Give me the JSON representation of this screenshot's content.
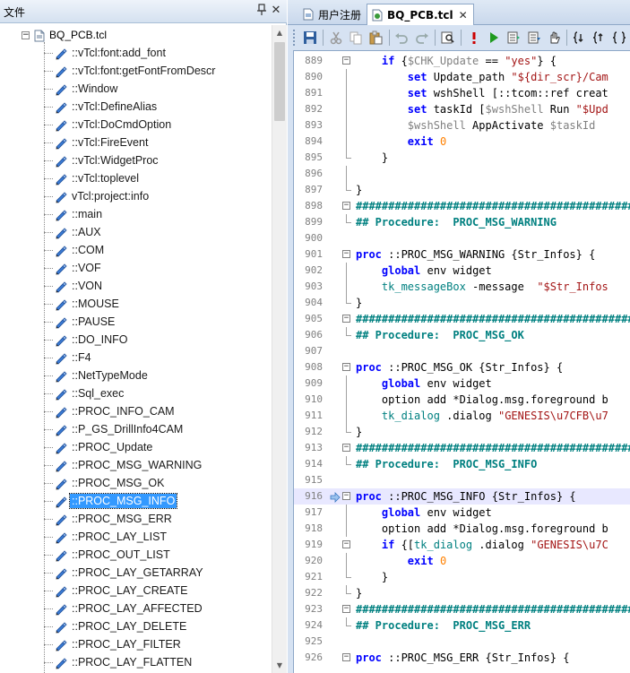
{
  "left_panel": {
    "title": "文件",
    "pin": "ᛘ",
    "close": "✕",
    "tree": {
      "root": "BQ_PCB.tcl",
      "selected_index": 26,
      "items": [
        "::vTcl:font:add_font",
        "::vTcl:font:getFontFromDescr",
        "::Window",
        "::vTcl:DefineAlias",
        "::vTcl:DoCmdOption",
        "::vTcl:FireEvent",
        "::vTcl:WidgetProc",
        "::vTcl:toplevel",
        "vTcl:project:info",
        "::main",
        "::AUX",
        "::COM",
        "::VOF",
        "::VON",
        "::MOUSE",
        "::PAUSE",
        "::DO_INFO",
        "::F4",
        "::NetTypeMode",
        "::Sql_exec",
        "::PROC_INFO_CAM",
        "::P_GS_DrillInfo4CAM",
        "::PROC_Update",
        "::PROC_MSG_WARNING",
        "::PROC_MSG_OK",
        "::PROC_MSG_INFO",
        "::PROC_MSG_ERR",
        "::PROC_LAY_LIST",
        "::PROC_OUT_LIST",
        "::PROC_LAY_GETARRAY",
        "::PROC_LAY_CREATE",
        "::PROC_LAY_AFFECTED",
        "::PROC_LAY_DELETE",
        "::PROC_LAY_FILTER",
        "::PROC_LAY_FLATTEN"
      ]
    }
  },
  "tabs": [
    {
      "label": "用户注册",
      "active": false
    },
    {
      "label": "BQ_PCB.tcl",
      "active": true,
      "close": "✕"
    }
  ],
  "editor": {
    "current_line": "916",
    "lines": [
      {
        "n": "889",
        "fold": "box",
        "parts": [
          [
            "",
            "    "
          ],
          [
            "kw",
            "if"
          ],
          [
            "",
            " {"
          ],
          [
            "var-grey",
            "$CHK_Update"
          ],
          [
            "",
            " == "
          ],
          [
            "str",
            "\"yes\""
          ],
          [
            "",
            "} {"
          ]
        ]
      },
      {
        "n": "890",
        "fold": "line",
        "parts": [
          [
            "",
            "        "
          ],
          [
            "kw",
            "set"
          ],
          [
            "",
            " Update_path "
          ],
          [
            "str",
            "\"${dir_scr}/Cam"
          ]
        ]
      },
      {
        "n": "891",
        "fold": "line",
        "parts": [
          [
            "",
            "        "
          ],
          [
            "kw",
            "set"
          ],
          [
            "",
            " wshShell [::tcom::ref creat"
          ]
        ]
      },
      {
        "n": "892",
        "fold": "line",
        "parts": [
          [
            "",
            "        "
          ],
          [
            "kw",
            "set"
          ],
          [
            "",
            " taskId ["
          ],
          [
            "var-grey",
            "$wshShell"
          ],
          [
            "",
            " Run "
          ],
          [
            "str",
            "\"$Upd"
          ]
        ]
      },
      {
        "n": "893",
        "fold": "line",
        "parts": [
          [
            "",
            "        "
          ],
          [
            "var-grey",
            "$wshShell"
          ],
          [
            "",
            " AppActivate "
          ],
          [
            "var-grey",
            "$taskId"
          ]
        ]
      },
      {
        "n": "894",
        "fold": "line",
        "parts": [
          [
            "",
            "        "
          ],
          [
            "kw",
            "exit"
          ],
          [
            "",
            " "
          ],
          [
            "num",
            "0"
          ]
        ]
      },
      {
        "n": "895",
        "fold": "end",
        "parts": [
          [
            "",
            "    }"
          ]
        ]
      },
      {
        "n": "896",
        "fold": "line",
        "parts": []
      },
      {
        "n": "897",
        "fold": "end",
        "parts": [
          [
            "",
            "}"
          ]
        ]
      },
      {
        "n": "898",
        "fold": "box",
        "parts": [
          [
            "cmt",
            "###############################################"
          ]
        ]
      },
      {
        "n": "899",
        "fold": "end",
        "parts": [
          [
            "cmt",
            "## Procedure:  PROC_MSG_WARNING"
          ]
        ]
      },
      {
        "n": "900",
        "fold": "",
        "parts": []
      },
      {
        "n": "901",
        "fold": "box",
        "parts": [
          [
            "kw",
            "proc"
          ],
          [
            "",
            " ::PROC_MSG_WARNING {Str_Infos} {"
          ]
        ]
      },
      {
        "n": "902",
        "fold": "line",
        "parts": [
          [
            "",
            "    "
          ],
          [
            "kw",
            "global"
          ],
          [
            "",
            " env widget"
          ]
        ]
      },
      {
        "n": "903",
        "fold": "line",
        "parts": [
          [
            "",
            "    "
          ],
          [
            "fn",
            "tk_messageBox"
          ],
          [
            "",
            " -message  "
          ],
          [
            "str",
            "\"$Str_Infos"
          ]
        ]
      },
      {
        "n": "904",
        "fold": "end",
        "parts": [
          [
            "",
            "}"
          ]
        ]
      },
      {
        "n": "905",
        "fold": "box",
        "parts": [
          [
            "cmt",
            "###############################################"
          ]
        ]
      },
      {
        "n": "906",
        "fold": "end",
        "parts": [
          [
            "cmt",
            "## Procedure:  PROC_MSG_OK"
          ]
        ]
      },
      {
        "n": "907",
        "fold": "",
        "parts": []
      },
      {
        "n": "908",
        "fold": "box",
        "parts": [
          [
            "kw",
            "proc"
          ],
          [
            "",
            " ::PROC_MSG_OK {Str_Infos} {"
          ]
        ]
      },
      {
        "n": "909",
        "fold": "line",
        "parts": [
          [
            "",
            "    "
          ],
          [
            "kw",
            "global"
          ],
          [
            "",
            " env widget"
          ]
        ]
      },
      {
        "n": "910",
        "fold": "line",
        "parts": [
          [
            "",
            "    "
          ],
          [
            "",
            "option add *Dialog.msg.foreground b"
          ]
        ]
      },
      {
        "n": "911",
        "fold": "line",
        "parts": [
          [
            "",
            "    "
          ],
          [
            "fn",
            "tk_dialog"
          ],
          [
            "",
            " .dialog "
          ],
          [
            "str",
            "\"GENESIS\\u7CFB\\u7"
          ]
        ]
      },
      {
        "n": "912",
        "fold": "end",
        "parts": [
          [
            "",
            "}"
          ]
        ]
      },
      {
        "n": "913",
        "fold": "box",
        "parts": [
          [
            "cmt",
            "###############################################"
          ]
        ]
      },
      {
        "n": "914",
        "fold": "end",
        "parts": [
          [
            "cmt",
            "## Procedure:  PROC_MSG_INFO"
          ]
        ]
      },
      {
        "n": "915",
        "fold": "",
        "parts": []
      },
      {
        "n": "916",
        "fold": "box",
        "marker": "arrow",
        "parts": [
          [
            "kw",
            "proc"
          ],
          [
            "",
            " ::PROC_MSG_INFO {Str_Infos} {"
          ]
        ]
      },
      {
        "n": "917",
        "fold": "line",
        "parts": [
          [
            "",
            "    "
          ],
          [
            "kw",
            "global"
          ],
          [
            "",
            " env widget"
          ]
        ]
      },
      {
        "n": "918",
        "fold": "line",
        "parts": [
          [
            "",
            "    "
          ],
          [
            "",
            "option add *Dialog.msg.foreground b"
          ]
        ]
      },
      {
        "n": "919",
        "fold": "box",
        "parts": [
          [
            "",
            "    "
          ],
          [
            "kw",
            "if"
          ],
          [
            "",
            " {["
          ],
          [
            "fn",
            "tk_dialog"
          ],
          [
            "",
            " .dialog "
          ],
          [
            "str",
            "\"GENESIS\\u7C"
          ]
        ]
      },
      {
        "n": "920",
        "fold": "line",
        "parts": [
          [
            "",
            "        "
          ],
          [
            "kw",
            "exit"
          ],
          [
            "",
            " "
          ],
          [
            "num",
            "0"
          ]
        ]
      },
      {
        "n": "921",
        "fold": "end",
        "parts": [
          [
            "",
            "    }"
          ]
        ]
      },
      {
        "n": "922",
        "fold": "end",
        "parts": [
          [
            "",
            "}"
          ]
        ]
      },
      {
        "n": "923",
        "fold": "box",
        "parts": [
          [
            "cmt",
            "###############################################"
          ]
        ]
      },
      {
        "n": "924",
        "fold": "end",
        "parts": [
          [
            "cmt",
            "## Procedure:  PROC_MSG_ERR"
          ]
        ]
      },
      {
        "n": "925",
        "fold": "",
        "parts": []
      },
      {
        "n": "926",
        "fold": "box",
        "parts": [
          [
            "kw",
            "proc"
          ],
          [
            "",
            " ::PROC_MSG_ERR {Str_Infos} {"
          ]
        ]
      }
    ]
  },
  "colors": {
    "selection": "#3399ff",
    "keyword": "#0000ff",
    "comment": "#008080",
    "string": "#a31515",
    "number": "#ff8000"
  }
}
